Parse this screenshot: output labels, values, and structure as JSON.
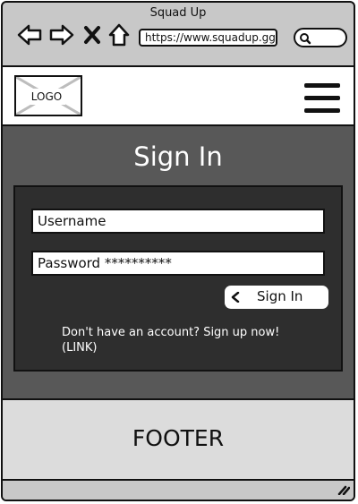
{
  "window": {
    "title": "Squad Up"
  },
  "browser": {
    "url": "https://www.squadup.gg/",
    "icons": [
      "back-arrow-icon",
      "forward-arrow-icon",
      "close-icon",
      "home-icon",
      "search-icon"
    ]
  },
  "header": {
    "logo_label": "LOGO",
    "menu_icon": "hamburger-menu-icon"
  },
  "main": {
    "title": "Sign In",
    "username_value": "Username",
    "password_value": "Password **********",
    "signin_label": "Sign In",
    "signin_icon": "chevron-left-icon",
    "signup_text": "Don't have an account? Sign up now! (LINK)"
  },
  "footer": {
    "label": "FOOTER"
  },
  "colors": {
    "chrome": "#c8c8c8",
    "main_bg": "#585858",
    "card_bg": "#2e2e2e",
    "footer_bg": "#dcdcdc"
  }
}
